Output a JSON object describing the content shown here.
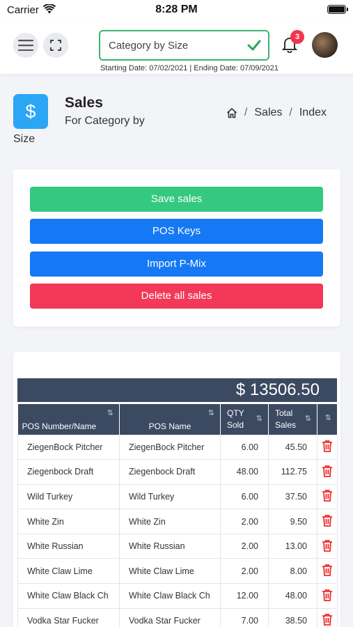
{
  "status_bar": {
    "carrier": "Carrier",
    "time": "8:28 PM"
  },
  "header": {
    "category_value": "Category by Size",
    "notification_count": "3",
    "date_range": "Starting Date: 07/02/2021 | Ending Date: 07/09/2021"
  },
  "page": {
    "icon_symbol": "$",
    "title": "Sales",
    "subtitle_line1": "For Category by",
    "subtitle_line2": "Size",
    "breadcrumb": [
      "Sales",
      "Index"
    ]
  },
  "actions": {
    "save": "Save sales",
    "pos_keys": "POS Keys",
    "import": "Import P-Mix",
    "delete_all": "Delete all sales"
  },
  "table": {
    "total": "$ 13506.50",
    "headers": {
      "pos_number": "POS Number/Name",
      "pos_name": "POS Name",
      "qty_line1": "QTY",
      "qty_line2": "Sold",
      "total_line1": "Total",
      "total_line2": "Sales"
    },
    "rows": [
      {
        "number_name": "ZiegenBock Pitcher",
        "pos_name": "ZiegenBock Pitcher",
        "qty": "6.00",
        "sales": "45.50"
      },
      {
        "number_name": "Ziegenbock Draft",
        "pos_name": "Ziegenbock Draft",
        "qty": "48.00",
        "sales": "112.75"
      },
      {
        "number_name": "Wild Turkey",
        "pos_name": "Wild Turkey",
        "qty": "6.00",
        "sales": "37.50"
      },
      {
        "number_name": "White Zin",
        "pos_name": "White Zin",
        "qty": "2.00",
        "sales": "9.50"
      },
      {
        "number_name": "White Russian",
        "pos_name": "White Russian",
        "qty": "2.00",
        "sales": "13.00"
      },
      {
        "number_name": "White Claw Lime",
        "pos_name": "White Claw Lime",
        "qty": "2.00",
        "sales": "8.00"
      },
      {
        "number_name": "White Claw Black Ch",
        "pos_name": "White Claw Black Ch",
        "qty": "12.00",
        "sales": "48.00"
      },
      {
        "number_name": "Vodka Star Fucker",
        "pos_name": "Vodka Star Fucker",
        "qty": "7.00",
        "sales": "38.50"
      }
    ]
  },
  "colors": {
    "success": "#34c97f",
    "primary": "#1579f6",
    "danger": "#f33858",
    "table_header": "#3b4a60",
    "accent_icon": "#2aa6f5"
  },
  "icons": [
    "wifi-icon",
    "battery-icon",
    "menu-icon",
    "expand-icon",
    "check-icon",
    "bell-icon",
    "avatar",
    "dollar-icon",
    "home-icon",
    "sort-icon",
    "trash-icon"
  ]
}
